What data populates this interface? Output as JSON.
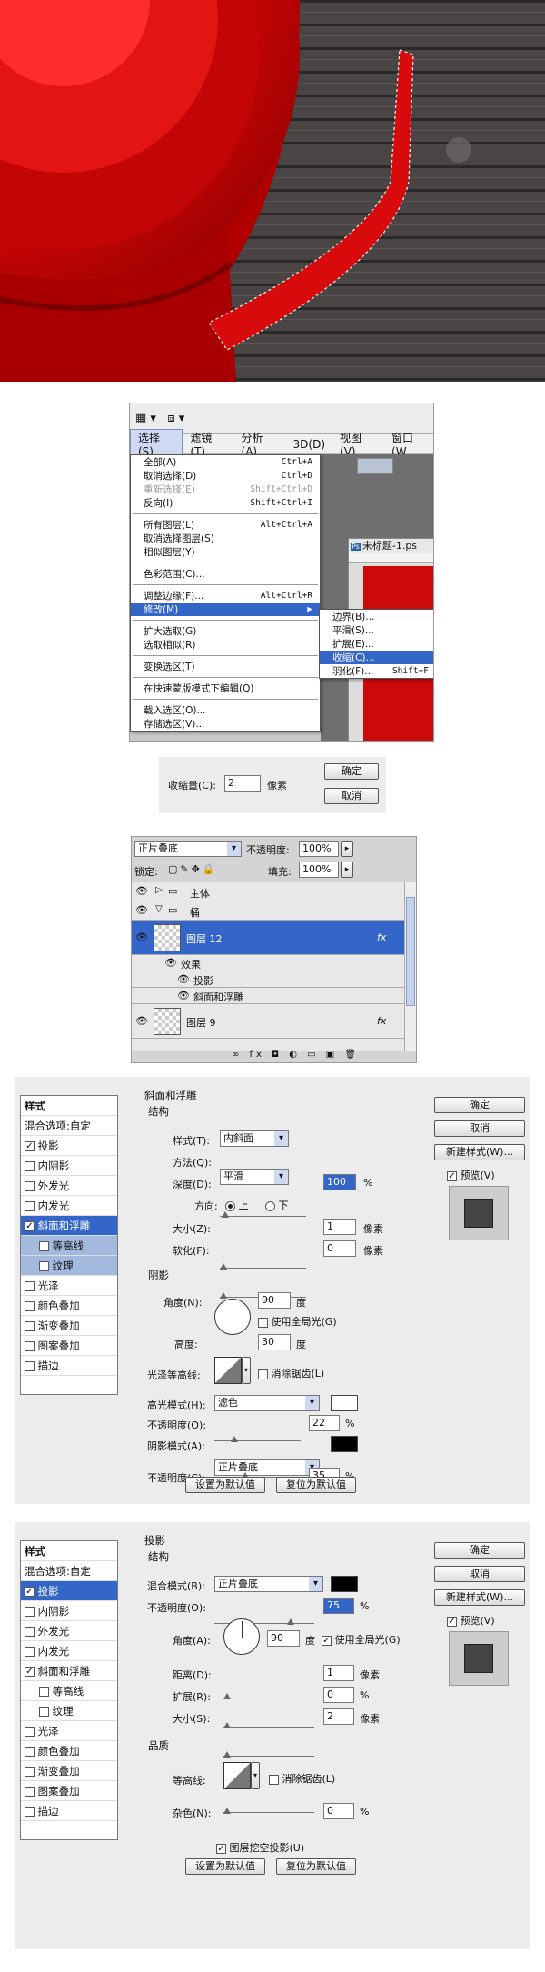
{
  "menu": {
    "toolbar_tabs": [
      "选择(S)",
      "滤镜(T)",
      "分析(A)",
      "3D(D)",
      "视图(V)",
      "窗口(W"
    ],
    "items": [
      {
        "label": "全部(A)",
        "shortcut": "Ctrl+A"
      },
      {
        "label": "取消选择(D)",
        "shortcut": "Ctrl+D"
      },
      {
        "label": "重新选择(E)",
        "shortcut": "Shift+Ctrl+D",
        "disabled": true
      },
      {
        "label": "反向(I)",
        "shortcut": "Shift+Ctrl+I"
      },
      {
        "label": "所有图层(L)",
        "shortcut": "Alt+Ctrl+A"
      },
      {
        "label": "取消选择图层(S)",
        "shortcut": ""
      },
      {
        "label": "相似图层(Y)",
        "shortcut": ""
      },
      {
        "label": "色彩范围(C)...",
        "shortcut": ""
      },
      {
        "label": "调整边缘(F)...",
        "shortcut": "Alt+Ctrl+R"
      },
      {
        "label": "修改(M)",
        "shortcut": "▶"
      },
      {
        "label": "扩大选取(G)",
        "shortcut": ""
      },
      {
        "label": "选取相似(R)",
        "shortcut": ""
      },
      {
        "label": "变换选区(T)",
        "shortcut": ""
      },
      {
        "label": "在快速蒙版模式下编辑(Q)",
        "shortcut": ""
      },
      {
        "label": "载入选区(O)...",
        "shortcut": ""
      },
      {
        "label": "存储选区(V)...",
        "shortcut": ""
      }
    ],
    "submenu": [
      {
        "label": "边界(B)...",
        "shortcut": ""
      },
      {
        "label": "平滑(S)...",
        "shortcut": ""
      },
      {
        "label": "扩展(E)...",
        "shortcut": ""
      },
      {
        "label": "收缩(C)...",
        "shortcut": ""
      },
      {
        "label": "羽化(F)...",
        "shortcut": "Shift+F"
      }
    ],
    "doc_title": "未标题-1.ps",
    "ps_badge": "Ps"
  },
  "contract_dialog": {
    "label": "收缩量(C):",
    "value": "2",
    "unit": "像素",
    "ok": "确定",
    "cancel": "取消"
  },
  "layers": {
    "blend_mode": "正片叠底",
    "opacity_label": "不透明度:",
    "opacity": "100%",
    "lock_label": "锁定:",
    "fill_label": "填充:",
    "fill": "100%",
    "rows": [
      {
        "name": "主体"
      },
      {
        "name": "桶"
      },
      {
        "name": "图层 12",
        "fx": "fx"
      },
      {
        "name": "效果"
      },
      {
        "name": "投影"
      },
      {
        "name": "斜面和浮雕"
      },
      {
        "name": "图层 9",
        "fx": "fx"
      }
    ],
    "footer_icons": "∞ fx ◘ ◐ ▭ ▣ 🗑"
  },
  "bevel_dialog": {
    "list_header": "样式",
    "list": [
      "混合选项:自定",
      "投影",
      "内阴影",
      "外发光",
      "内发光",
      "斜面和浮雕",
      "等高线",
      "纹理",
      "光泽",
      "颜色叠加",
      "渐变叠加",
      "图案叠加",
      "描边"
    ],
    "title": "斜面和浮雕",
    "structure": "结构",
    "style_label": "样式(T):",
    "style_value": "内斜面",
    "method_label": "方法(Q):",
    "method_value": "平滑",
    "depth_label": "深度(D):",
    "depth_value": "100",
    "direction_label": "方向:",
    "dir_up": "上",
    "dir_down": "下",
    "size_label": "大小(Z):",
    "size_value": "1",
    "soften_label": "软化(F):",
    "soften_value": "0",
    "shading": "阴影",
    "angle_label": "角度(N):",
    "angle_value": "90",
    "global_light": "使用全局光(G)",
    "altitude_label": "高度:",
    "altitude_value": "30",
    "gloss_label": "光泽等高线:",
    "antialias": "消除锯齿(L)",
    "hl_mode_label": "高光模式(H):",
    "hl_mode_value": "滤色",
    "hl_opacity_label": "不透明度(O):",
    "hl_opacity_value": "22",
    "sh_mode_label": "阴影模式(A):",
    "sh_mode_value": "正片叠底",
    "sh_opacity_label": "不透明度(C):",
    "sh_opacity_value": "35",
    "pct": "%",
    "px": "像素",
    "deg": "度",
    "make_default": "设置为默认值",
    "reset_default": "复位为默认值",
    "ok": "确定",
    "cancel": "取消",
    "new_style": "新建样式(W)...",
    "preview": "预览(V)",
    "highlight_color": "#ffffff",
    "shadow_color": "#000000"
  },
  "shadow_dialog": {
    "list_header": "样式",
    "list": [
      "混合选项:自定",
      "投影",
      "内阴影",
      "外发光",
      "内发光",
      "斜面和浮雕",
      "等高线",
      "纹理",
      "光泽",
      "颜色叠加",
      "渐变叠加",
      "图案叠加",
      "描边"
    ],
    "title": "投影",
    "structure": "结构",
    "blend_label": "混合模式(B):",
    "blend_value": "正片叠底",
    "opacity_label": "不透明度(O):",
    "opacity_value": "75",
    "angle_label": "角度(A):",
    "angle_value": "90",
    "global_light": "使用全局光(G)",
    "distance_label": "距离(D):",
    "distance_value": "1",
    "spread_label": "扩展(R):",
    "spread_value": "0",
    "size_label": "大小(S):",
    "size_value": "2",
    "quality": "品质",
    "contour_label": "等高线:",
    "antialias": "消除锯齿(L)",
    "noise_label": "杂色(N):",
    "noise_value": "0",
    "knockout": "图层挖空投影(U)",
    "pct": "%",
    "px": "像素",
    "deg": "度",
    "make_default": "设置为默认值",
    "reset_default": "复位为默认值",
    "ok": "确定",
    "cancel": "取消",
    "new_style": "新建样式(W)...",
    "preview": "预览(V)",
    "shadow_color": "#000000"
  }
}
